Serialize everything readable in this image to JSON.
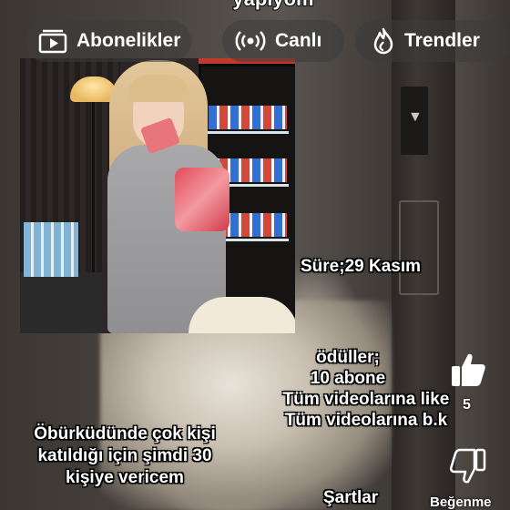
{
  "top_caption": "yapıyom",
  "nav": {
    "subscriptions": "Abonelikler",
    "live": "Canlı",
    "trending": "Trendler"
  },
  "overlay": {
    "duration": "Süre;29  Kasım",
    "rewards_title": "ödüller;",
    "rewards_line1": "10 abone",
    "rewards_line2": "Tüm videolarına like",
    "rewards_line3": "Tüm videolarına b.k",
    "note_line1": "Öbürküdünde  çok kişi",
    "note_line2": "katıldığı için şimdi 30",
    "note_line3": "kişiye vericem",
    "conditions": "Şartlar"
  },
  "actions": {
    "like_count": "5",
    "dislike_label": "Beğenme"
  },
  "icons": {
    "subscriptions": "subscriptions-icon",
    "live": "live-broadcast-icon",
    "trending": "trending-flame-icon",
    "like": "thumbs-up-icon",
    "dislike": "thumbs-down-icon"
  }
}
